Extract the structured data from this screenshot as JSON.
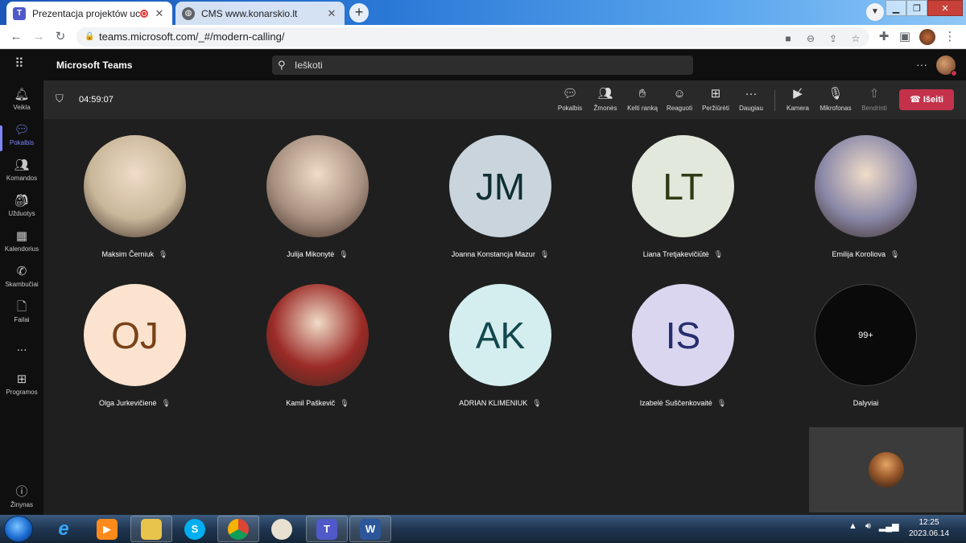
{
  "browser": {
    "tabs": [
      {
        "title": "Prezentacja projektów ucznió",
        "recording": true,
        "active": true
      },
      {
        "title": "CMS www.konarskio.lt",
        "active": false
      }
    ],
    "url": "teams.microsoft.com/_#/modern-calling/"
  },
  "teams": {
    "app_title": "Microsoft Teams",
    "search_placeholder": "Ieškoti",
    "rail": [
      {
        "label": "Veikla",
        "icon": "bell-icon"
      },
      {
        "label": "Pokalbis",
        "icon": "chat-icon"
      },
      {
        "label": "Komandos",
        "icon": "teams-icon"
      },
      {
        "label": "Užduotys",
        "icon": "assignments-icon"
      },
      {
        "label": "Kalendorius",
        "icon": "calendar-icon"
      },
      {
        "label": "Skambučiai",
        "icon": "phone-icon"
      },
      {
        "label": "Failai",
        "icon": "file-icon"
      },
      {
        "label": "...",
        "icon": "more-icon"
      },
      {
        "label": "Programos",
        "icon": "apps-icon"
      },
      {
        "label": "Žinynas",
        "icon": "help-icon"
      }
    ],
    "call": {
      "timer": "04:59:07",
      "controls": [
        {
          "label": "Pokalbis",
          "icon": "chat-icon"
        },
        {
          "label": "Žmonės",
          "icon": "people-icon"
        },
        {
          "label": "Kelti ranką",
          "icon": "hand-icon"
        },
        {
          "label": "Reaguoti",
          "icon": "emoji-icon"
        },
        {
          "label": "Peržiūrėti",
          "icon": "view-icon"
        },
        {
          "label": "Daugiau",
          "icon": "more-icon"
        },
        {
          "label": "Kamera",
          "icon": "camera-off-icon"
        },
        {
          "label": "Mikrofonas",
          "icon": "mic-off-icon"
        },
        {
          "label": "Bendrinti",
          "icon": "share-icon",
          "disabled": true
        }
      ],
      "leave_label": "Išeiti"
    },
    "participants": [
      {
        "name": "Maksim Černiuk",
        "initials": "",
        "photo": true,
        "bg": "#c9b79a",
        "muted": true
      },
      {
        "name": "Julija Mikonytė",
        "initials": "",
        "photo": true,
        "bg": "#a89080",
        "muted": true
      },
      {
        "name": "Joanna Konstancja Mazur",
        "initials": "JM",
        "photo": false,
        "bg": "#c9d4dc",
        "fg": "#0f2e33",
        "muted": true
      },
      {
        "name": "Liana Tretjakevičiūtė",
        "initials": "LT",
        "photo": false,
        "bg": "#e2e8dc",
        "fg": "#2f3a14",
        "muted": true
      },
      {
        "name": "Emilija Koroliova",
        "initials": "",
        "photo": true,
        "bg": "#8a88a8",
        "muted": true
      },
      {
        "name": "Olga Jurkevičienė",
        "initials": "OJ",
        "photo": false,
        "bg": "#fbe3d0",
        "fg": "#7a4218",
        "muted": true
      },
      {
        "name": "Kamil Paškevič",
        "initials": "",
        "photo": true,
        "bg": "#9b2a26",
        "muted": true
      },
      {
        "name": "ADRIAN KLIMENIUK",
        "initials": "AK",
        "photo": false,
        "bg": "#d4eef0",
        "fg": "#12484d",
        "muted": true
      },
      {
        "name": "Izabelė Suščenkovaitė",
        "initials": "IS",
        "photo": false,
        "bg": "#dbd6f0",
        "fg": "#252e6e",
        "muted": true
      },
      {
        "name": "Dalyviai",
        "initials": "99+",
        "photo": false,
        "bg": "#0a0a0a",
        "fg": "#ffffff",
        "muted": false
      }
    ]
  },
  "taskbar": {
    "time": "12:25",
    "date": "2023.06.14"
  }
}
